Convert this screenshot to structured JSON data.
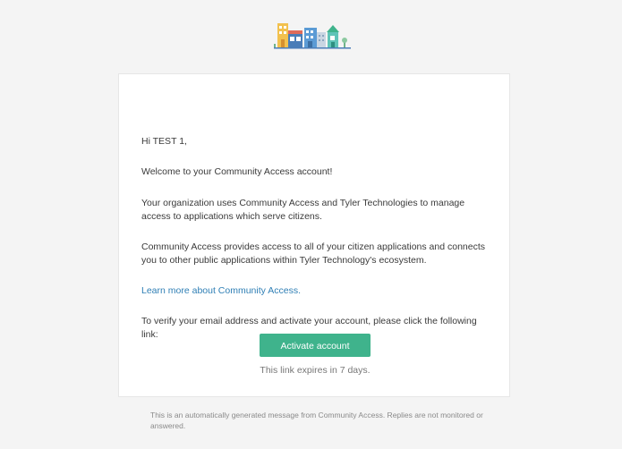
{
  "email": {
    "greeting": "Hi TEST 1,",
    "welcome": "Welcome to your Community Access account!",
    "org_paragraph": "Your organization uses Community Access and Tyler Technologies to manage access to applications which serve citizens.",
    "provides_paragraph": "Community Access provides access to all of your citizen applications and connects you to other public applications within Tyler Technology's ecosystem.",
    "learn_more_link": "Learn more about Community Access.",
    "verify_paragraph": "To verify your email address and activate your account, please click the following link:",
    "activate_button": "Activate account",
    "expires_note": "This link expires in 7 days."
  },
  "footer": {
    "text": "This is an automatically generated message from Community Access. Replies are not monitored or answered."
  },
  "colors": {
    "button": "#3fb38c",
    "link": "#2f7fb5",
    "background": "#f4f4f4"
  },
  "icons": {
    "logo": "community-buildings-logo"
  }
}
